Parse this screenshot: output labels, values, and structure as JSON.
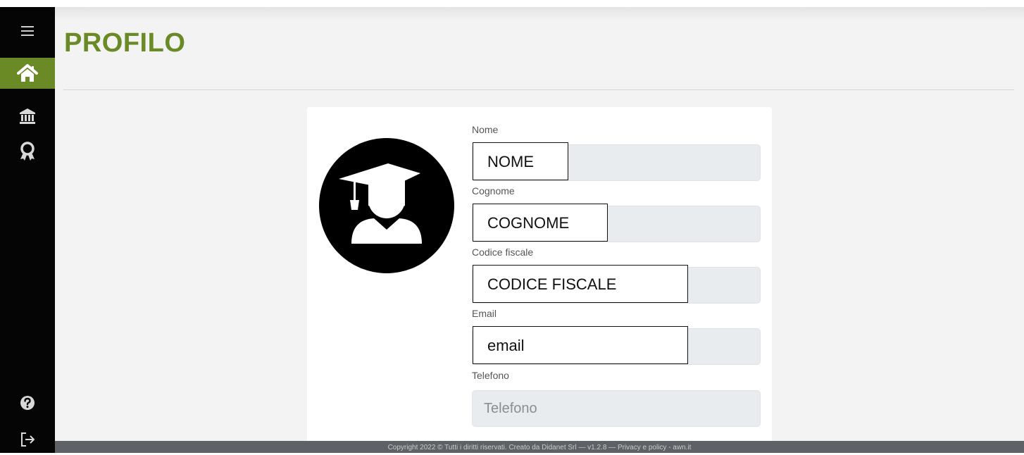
{
  "sidebar": {
    "items": [
      {
        "icon": "hamburger-menu-icon"
      },
      {
        "icon": "home-icon",
        "active": true
      },
      {
        "icon": "institution-icon"
      },
      {
        "icon": "award-icon"
      },
      {
        "icon": "help-icon"
      },
      {
        "icon": "logout-icon"
      }
    ],
    "active_color": "#6a8a25"
  },
  "page": {
    "title": "PROFILO",
    "title_color": "#6a8a25"
  },
  "profile": {
    "avatar_icon": "graduate-avatar-icon",
    "fields": [
      {
        "label": "Nome",
        "value": "NOME"
      },
      {
        "label": "Cognome",
        "value": "COGNOME"
      },
      {
        "label": "Codice fiscale",
        "value": "CODICE FISCALE"
      },
      {
        "label": "Email",
        "value": "email"
      },
      {
        "label": "Telefono",
        "placeholder": "Telefono"
      }
    ]
  },
  "footer": {
    "text": "Copyright 2022 © Tutti i diritti riservati. Creato da Didanet Srl — v1.2.8 — Privacy e policy - awn.it"
  }
}
